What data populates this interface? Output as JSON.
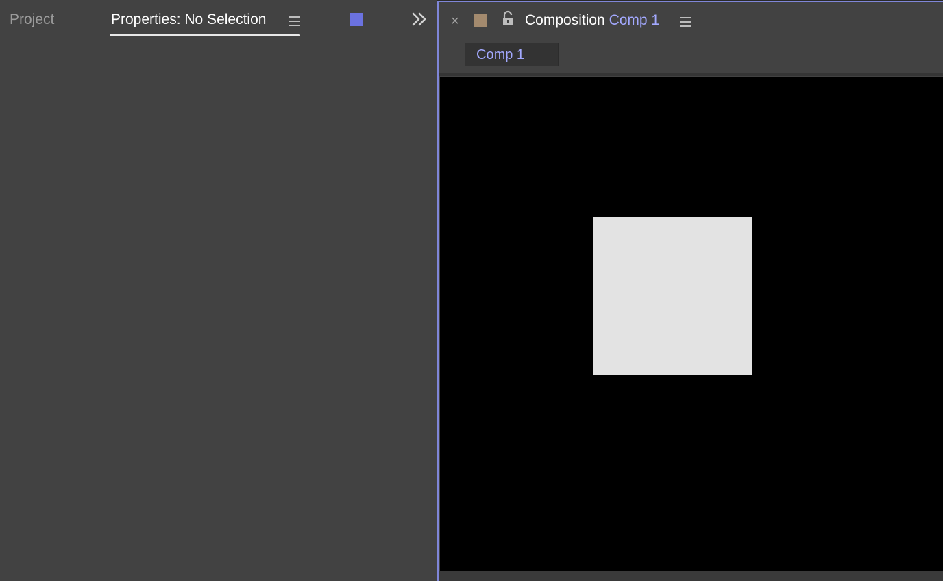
{
  "left_panel": {
    "tabs": [
      {
        "label": "Project",
        "active": false
      },
      {
        "label": "Properties: No Selection",
        "active": true
      }
    ],
    "label_color_swatch": "#6b72e0",
    "overflow_icon": "double-chevron-right-icon",
    "menu_icon": "hamburger-menu-icon"
  },
  "composition_panel": {
    "close_glyph": "×",
    "label_color_swatch": "#a38a6e",
    "lock_icon": "unlocked-padlock-icon",
    "title_label": "Composition",
    "title_comp_name": "Comp 1",
    "menu_icon": "hamburger-menu-icon",
    "subtabs": [
      {
        "label": "Comp 1",
        "active": true
      }
    ],
    "viewer": {
      "background": "#000000",
      "layer_color": "#e3e3e3"
    }
  },
  "colors": {
    "panel_bg": "#424242",
    "accent_blue": "#a3a9ff",
    "active_border": "#7f86d8"
  }
}
